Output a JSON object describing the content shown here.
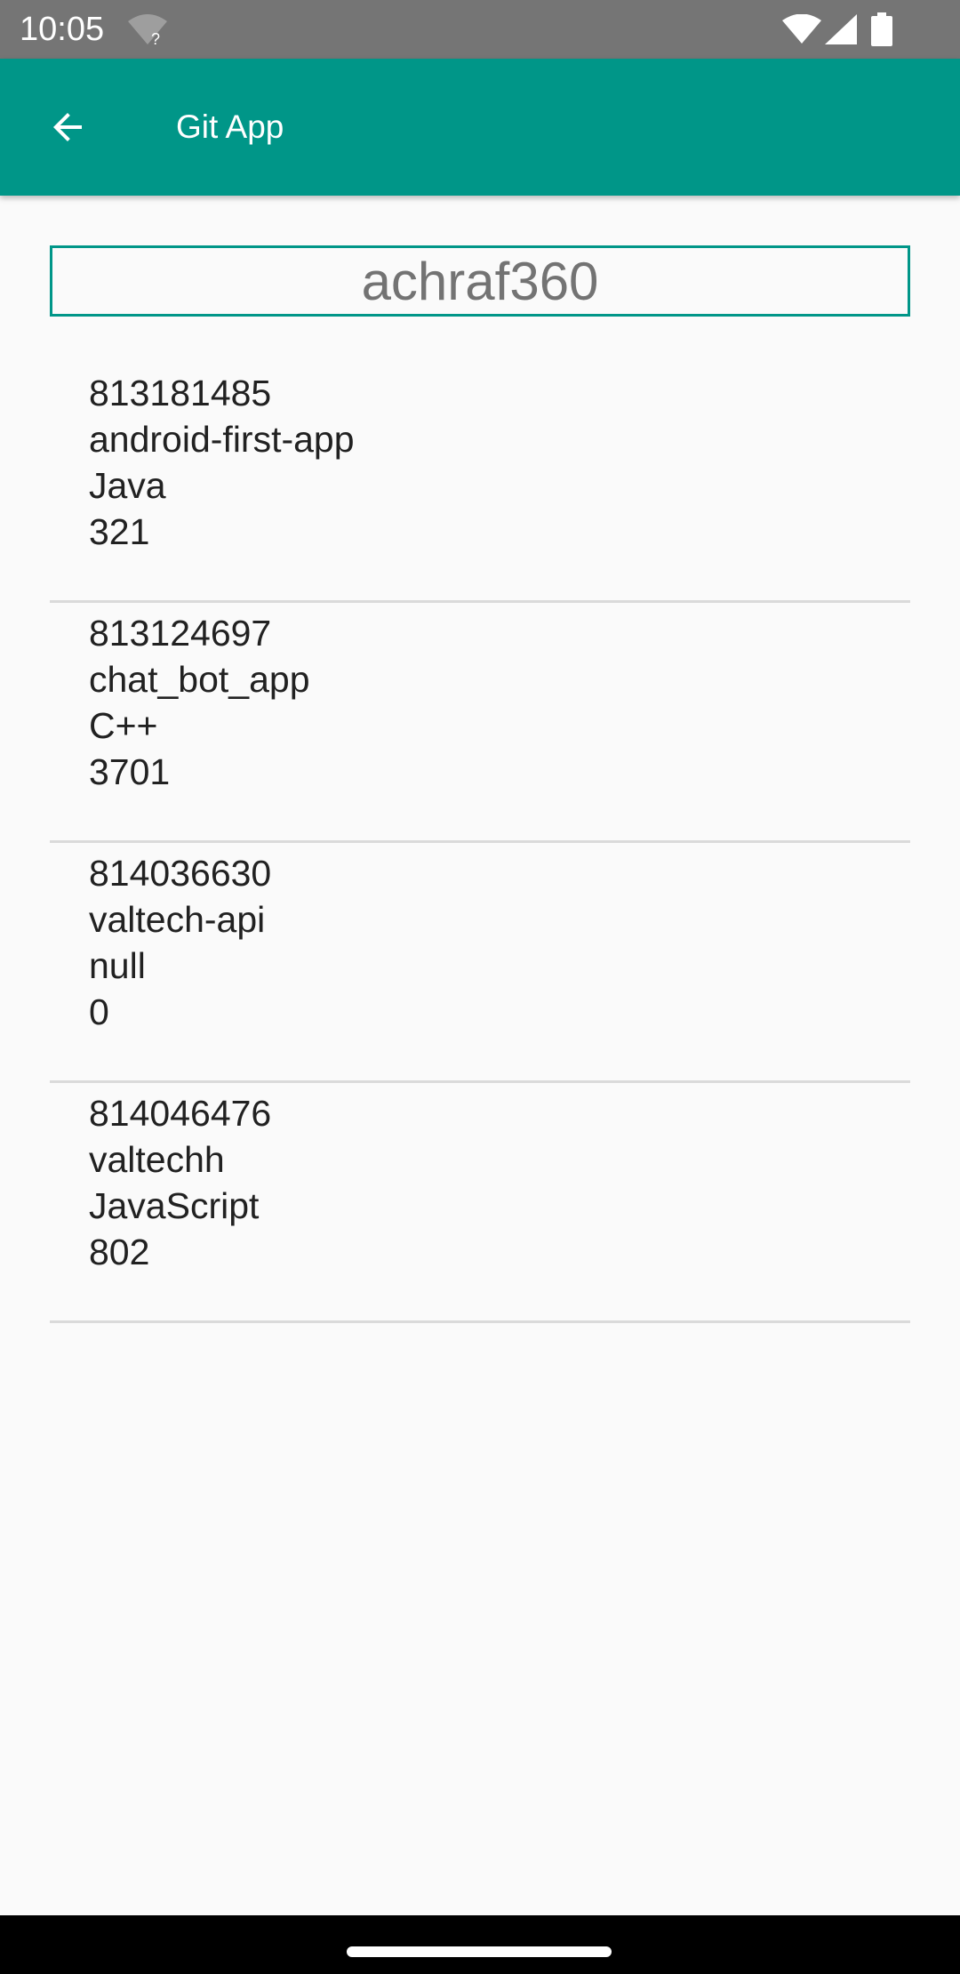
{
  "status_bar": {
    "time": "10:05",
    "wifi_unknown_mark": "?",
    "icons": [
      "wifi-question-icon",
      "wifi-icon",
      "signal-icon",
      "battery-icon"
    ],
    "background_color": "#757575"
  },
  "app_bar": {
    "title": "Git App",
    "back_icon": "arrow-back-icon",
    "background_color": "#009688"
  },
  "search": {
    "value": "achraf360",
    "border_color": "#009688"
  },
  "repos": [
    {
      "id": "813181485",
      "name": "android-first-app",
      "language": "Java",
      "size": "321"
    },
    {
      "id": "813124697",
      "name": "chat_bot_app",
      "language": "C++",
      "size": "3701"
    },
    {
      "id": "814036630",
      "name": "valtech-api",
      "language": "null",
      "size": "0"
    },
    {
      "id": "814046476",
      "name": "valtechh",
      "language": "JavaScript",
      "size": "802"
    }
  ]
}
